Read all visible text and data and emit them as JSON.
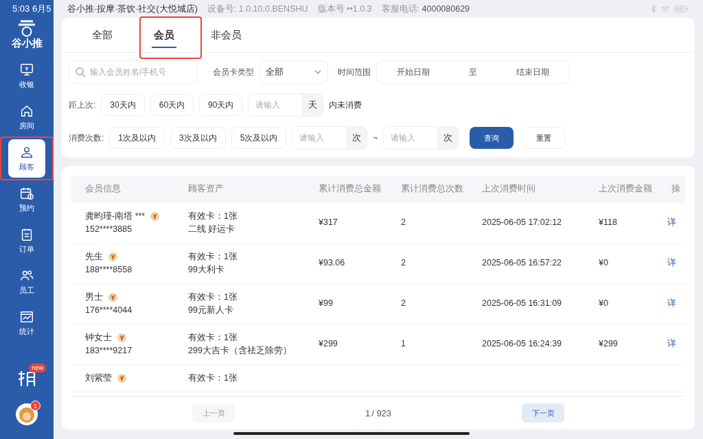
{
  "status_bar": {
    "time": "5:03",
    "date": "6月5",
    "store": "谷小推·按摩·茶饮·社交(大悦城店)",
    "device": "设备号: 1.0.10.0.BENSHU",
    "version": "版本号 ••1.0.3",
    "phone_label": "客服电话:",
    "phone": "4000080629"
  },
  "sidebar": {
    "logo_text": "谷小推",
    "items": [
      {
        "label": "收银",
        "selected": false
      },
      {
        "label": "房间",
        "selected": false
      },
      {
        "label": "顾客",
        "selected": true
      },
      {
        "label": "预约",
        "selected": false
      },
      {
        "label": "订单",
        "selected": false
      },
      {
        "label": "员工",
        "selected": false
      },
      {
        "label": "统计",
        "selected": false
      }
    ],
    "new_badge": "new",
    "avatar_badge": "1"
  },
  "tabs": [
    {
      "label": "全部",
      "selected": false
    },
    {
      "label": "会员",
      "selected": true
    },
    {
      "label": "非会员",
      "selected": false
    }
  ],
  "filters": {
    "search": {
      "placeholder": "输入会员姓名/手机号"
    },
    "card_type_label": "会员卡类型",
    "card_type": "全部",
    "time_range_label": "时间范围",
    "start_placeholder": "开始日期",
    "range_sep": "至",
    "end_placeholder": "结束日期",
    "last_visit": {
      "label": "距上次:",
      "chips": [
        "30天内",
        "60天内",
        "90天内"
      ],
      "placeholder": "请输入",
      "unit": "天",
      "suffix": "内未消费"
    },
    "visits": {
      "label": "消费次数:",
      "chips": [
        "1次及以内",
        "3次及以内",
        "5次及以内"
      ],
      "min_placeholder": "请输入",
      "min_unit": "次",
      "sep": "~",
      "max_placeholder": "请输入",
      "max_unit": "次"
    },
    "buttons": [
      "查询",
      "重置"
    ]
  },
  "table": {
    "columns": [
      "会员信息",
      "顾客资产",
      "累计消费总金额",
      "累计消费总次数",
      "上次消费时间",
      "上次消费金额",
      "操"
    ],
    "rows": [
      {
        "name": "龚昀瑾-南塔 ***",
        "phone": "152****3885",
        "cards": "有效卡：1张",
        "card_name": "二线 好运卡",
        "total": "¥317",
        "count": "2",
        "last_time": "2025-06-05 17:02:12",
        "last_amount": "¥118",
        "action": "详"
      },
      {
        "name": "先生",
        "phone": "188****8558",
        "cards": "有效卡：1张",
        "card_name": "99大利卡",
        "total": "¥93.06",
        "count": "2",
        "last_time": "2025-06-05 16:57:22",
        "last_amount": "¥0",
        "action": "详"
      },
      {
        "name": "男士",
        "phone": "176****4044",
        "cards": "有效卡：1张",
        "card_name": "99元新人卡",
        "total": "¥99",
        "count": "2",
        "last_time": "2025-06-05 16:31:09",
        "last_amount": "¥0",
        "action": "详"
      },
      {
        "name": "钟女士",
        "phone": "183****9217",
        "cards": "有效卡：1张",
        "card_name": "299大吉卡（含祛乏除劳）",
        "total": "¥299",
        "count": "1",
        "last_time": "2025-06-05 16:24:39",
        "last_amount": "¥299",
        "action": "详"
      },
      {
        "name": "刘紫莹",
        "cards": "有效卡：1张"
      }
    ]
  },
  "pagination": {
    "prev": "上一页",
    "prev_disabled": true,
    "page": "1",
    "total": "/ 923",
    "next": "下一页"
  }
}
